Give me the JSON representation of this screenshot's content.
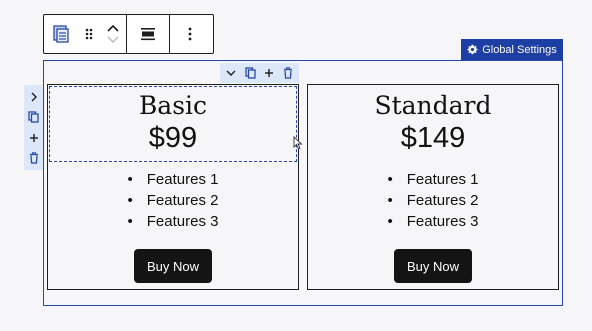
{
  "toolbar": {
    "block_icon": "pricing-block-icon",
    "drag_icon": "drag-handle-icon",
    "move_icons": [
      "chevron-up-icon",
      "chevron-down-icon"
    ],
    "align_icon": "align-icon",
    "options_icon": "more-vertical-icon"
  },
  "global_settings": {
    "label": "Global Settings",
    "icon": "gear-icon"
  },
  "side_toolbar": {
    "icons": [
      "chevron-right-icon",
      "copy-icon",
      "plus-icon",
      "trash-icon"
    ]
  },
  "column_toolbar": {
    "icons": [
      "chevron-down-icon",
      "copy-icon",
      "plus-icon",
      "trash-icon"
    ]
  },
  "plans": [
    {
      "name": "Basic",
      "price": "$99",
      "features": [
        "Features 1",
        "Features 2",
        "Features 3"
      ],
      "button": "Buy Now"
    },
    {
      "name": "Standard",
      "price": "$149",
      "features": [
        "Features 1",
        "Features 2",
        "Features 3"
      ],
      "button": "Buy Now"
    }
  ],
  "colors": {
    "accent": "#1d3ea3",
    "selection_bg": "#dce8f9",
    "button_bg": "#141414"
  }
}
